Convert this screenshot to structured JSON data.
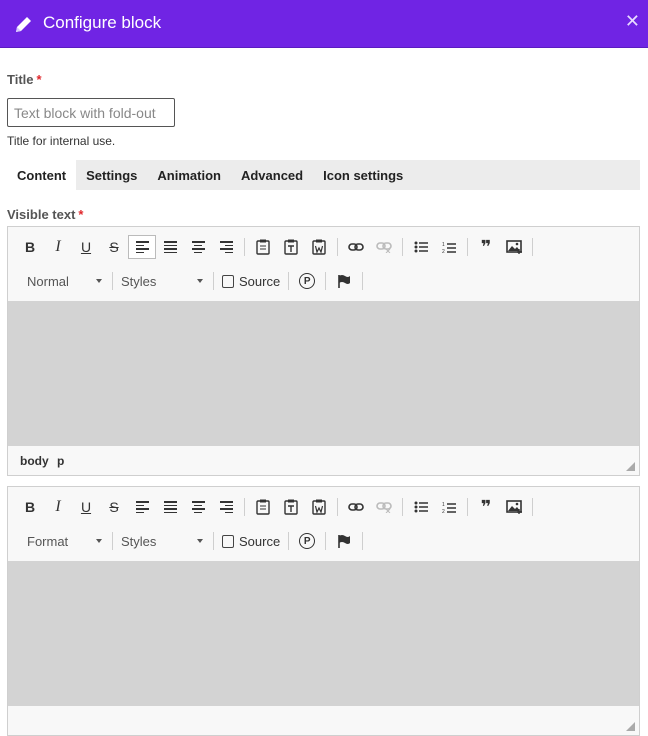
{
  "dialog": {
    "title": "Configure block",
    "close_glyph": "✕"
  },
  "fields": {
    "title_label": "Title",
    "required_mark": "*",
    "title_placeholder": "Text block with fold-out",
    "title_help": "Title for internal use.",
    "visible_text_label": "Visible text"
  },
  "tabs": [
    "Content",
    "Settings",
    "Animation",
    "Advanced",
    "Icon settings"
  ],
  "editor1": {
    "format_value": "Normal",
    "styles_value": "Styles",
    "source_label": "Source",
    "path": [
      "body",
      "p"
    ]
  },
  "editor2": {
    "format_value": "Format",
    "styles_value": "Styles",
    "source_label": "Source"
  },
  "toolbar_glyphs": {
    "bold": "B",
    "italic": "I",
    "underline": "U",
    "strike": "S",
    "paste_text": "T",
    "paste_word": "W",
    "quote": "❞",
    "p_circle": "P"
  },
  "colors": {
    "accent": "#7024e4",
    "required": "#e0262b",
    "editor_content_bg": "#d3d3d3"
  }
}
